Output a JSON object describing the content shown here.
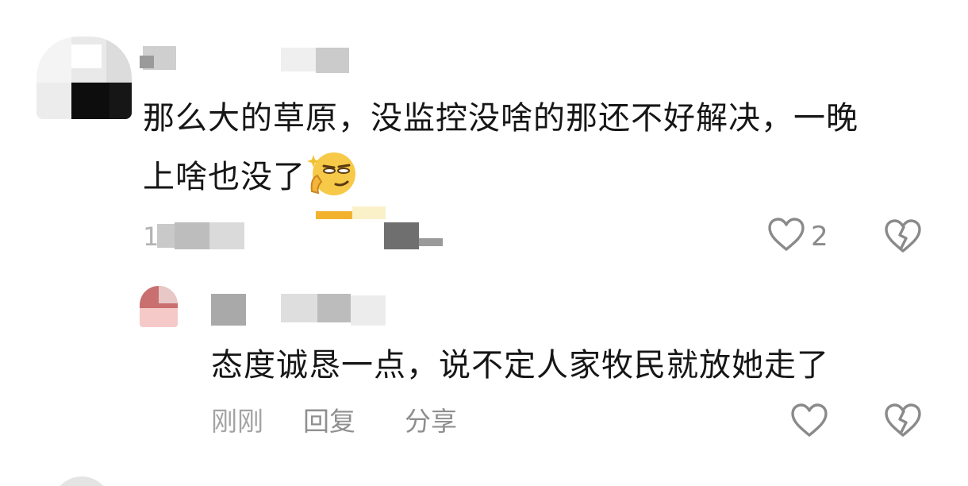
{
  "comment": {
    "text_line_1": "那么大的草原，没监控没啥的那还不好解决，一晚",
    "text_line_2": "上啥也没了",
    "emoji_icon": "sly-thinking-face-emoji-icon",
    "time_fragment": "1",
    "like_count": "2",
    "like_icon": "heart-outline-icon",
    "dislike_icon": "broken-heart-icon"
  },
  "reply": {
    "text": "态度诚恳一点，说不定人家牧民就放她走了",
    "time_label": "刚刚",
    "reply_label": "回复",
    "share_label": "分享",
    "like_icon": "heart-outline-icon",
    "dislike_icon": "broken-heart-icon"
  },
  "colors": {
    "text": "#161616",
    "meta": "#8f8f8f",
    "icon_stroke": "#8a8a8a",
    "background": "#ffffff"
  }
}
